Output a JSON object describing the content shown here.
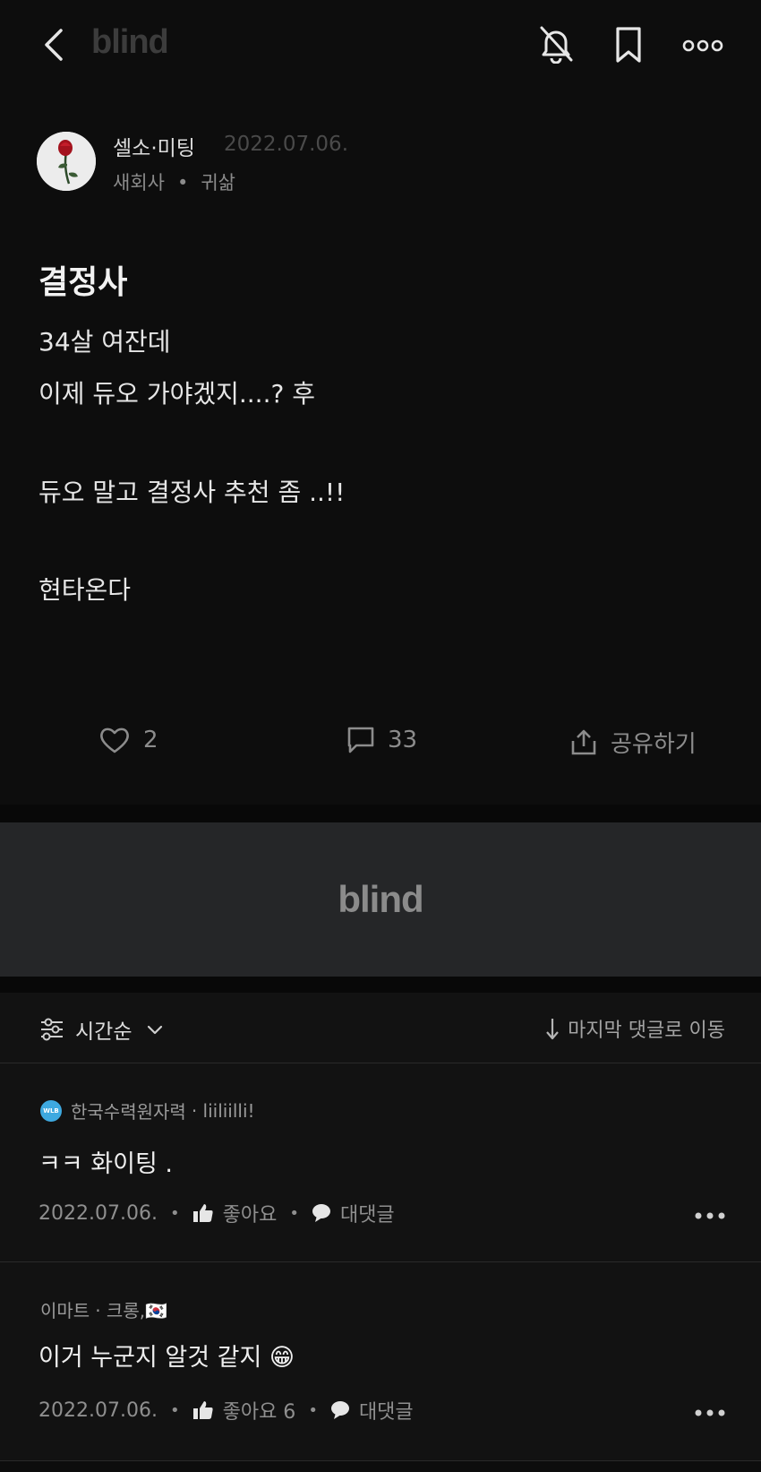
{
  "header": {
    "brand": "blind"
  },
  "post": {
    "author": "셀소·미팅",
    "date": "2022.07.06.",
    "company": "새회사",
    "meta_sep": "•",
    "board": "귀삶",
    "title": "결정사",
    "body": [
      "34살 여잔데",
      "이제 듀오 가야겠지....? 후",
      "듀오 말고 결정사 추천 좀 ..!!",
      "현타온다"
    ],
    "likes": "2",
    "comments": "33",
    "share_label": "공유하기"
  },
  "banner": {
    "logo": "blind"
  },
  "sort": {
    "label": "시간순",
    "jump_label": "마지막 댓글로 이동"
  },
  "comments": [
    {
      "company": "한국수력원자력",
      "nickname": "· liiliilli!",
      "text": "ㅋㅋ 화이팅 .",
      "date": "2022.07.06.",
      "like_label": "좋아요",
      "reply_label": "대댓글",
      "badge_text": "WLB"
    },
    {
      "company": "이마트",
      "nickname": "· 크롱,🇰🇷",
      "text": "이거 누군지 알것 같지 😁",
      "date": "2022.07.06.",
      "like_label": "좋아요 6",
      "reply_label": "대댓글"
    }
  ],
  "colors": {
    "background": "#0d0d0d",
    "banner": "#252628",
    "muted": "#8c8c8c",
    "accent_badge": "#3ea9e0"
  }
}
